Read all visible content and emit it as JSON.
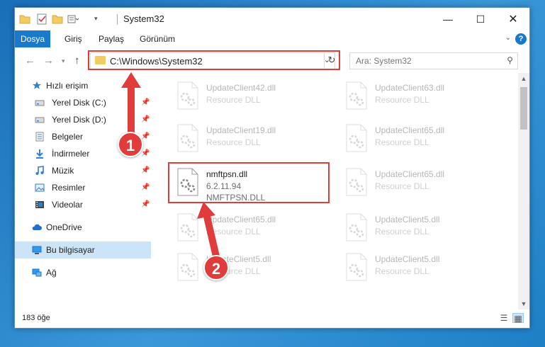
{
  "window": {
    "title": "System32"
  },
  "ribbon": {
    "tabs": [
      "Dosya",
      "Giriş",
      "Paylaş",
      "Görünüm"
    ],
    "help": "?"
  },
  "address": {
    "path": "C:\\Windows\\System32"
  },
  "search": {
    "placeholder": "Ara: System32"
  },
  "sidebar": {
    "items": [
      {
        "label": "Hızlı erişim",
        "icon": "star-icon",
        "pinned": false
      },
      {
        "label": "Yerel Disk (C:)",
        "icon": "drive-icon",
        "pinned": true
      },
      {
        "label": "Yerel Disk (D:)",
        "icon": "drive-icon",
        "pinned": true
      },
      {
        "label": "Belgeler",
        "icon": "documents-icon",
        "pinned": true
      },
      {
        "label": "İndirmeler",
        "icon": "download-icon",
        "pinned": true
      },
      {
        "label": "Müzik",
        "icon": "music-icon",
        "pinned": true
      },
      {
        "label": "Resimler",
        "icon": "pictures-icon",
        "pinned": true
      },
      {
        "label": "Videolar",
        "icon": "video-icon",
        "pinned": true
      },
      {
        "label": "OneDrive",
        "icon": "cloud-icon",
        "pinned": false
      },
      {
        "label": "Bu bilgisayar",
        "icon": "computer-icon",
        "pinned": false,
        "selected": true
      },
      {
        "label": "Ağ",
        "icon": "network-icon",
        "pinned": false
      }
    ]
  },
  "files": [
    {
      "name": "UpdateClient42.dll",
      "line2": "Resource DLL",
      "line3": "",
      "faded": true
    },
    {
      "name": "UpdateClient63.dll",
      "line2": "Resource DLL",
      "line3": "",
      "faded": true
    },
    {
      "name": "UpdateClient19.dll",
      "line2": "Resource DLL",
      "line3": "",
      "faded": true
    },
    {
      "name": "UpdateClient65.dll",
      "line2": "Resource DLL",
      "line3": "",
      "faded": true
    },
    {
      "name": "nmftpsn.dll",
      "line2": "6.2.11.94",
      "line3": "NMFTPSN.DLL",
      "faded": false
    },
    {
      "name": "UpdateClient65.dll",
      "line2": "Resource DLL",
      "line3": "",
      "faded": true
    },
    {
      "name": "UpdateClient65.dll",
      "line2": "Resource DLL",
      "line3": "",
      "faded": true
    },
    {
      "name": "UpdateClient5.dll",
      "line2": "Resource DLL",
      "line3": "",
      "faded": true
    },
    {
      "name": "UpdateClient5.dll",
      "line2": "Resource DLL",
      "line3": "",
      "faded": true
    },
    {
      "name": "UpdateClient5.dll",
      "line2": "Resource DLL",
      "line3": "",
      "faded": true
    }
  ],
  "status": {
    "item_count": "183 öğe"
  },
  "callouts": [
    "1",
    "2"
  ],
  "colors": {
    "accent": "#1979ca",
    "highlight": "#e03c3c",
    "selection": "#cce4f7"
  }
}
